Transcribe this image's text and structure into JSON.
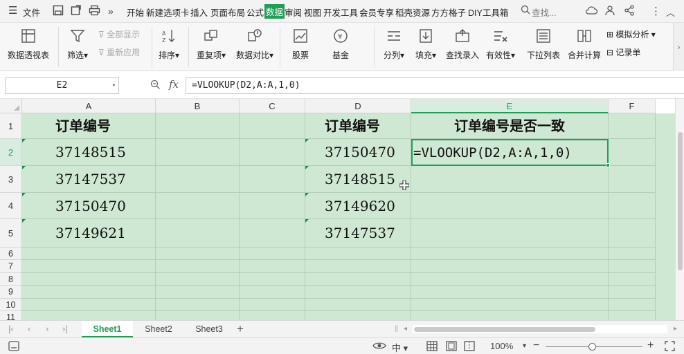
{
  "menubar": {
    "file_label": "文件",
    "tabs": [
      "开始",
      "新建选项卡",
      "插入",
      "页面布局",
      "公式",
      "数据",
      "审阅",
      "视图",
      "开发工具",
      "会员专享",
      "稻壳资源",
      "方方格子",
      "DIY工具箱"
    ],
    "active_tab": "数据",
    "search_label": "查找..."
  },
  "ribbon": {
    "pivot": "数据透视表",
    "filter": "筛选",
    "show_all": "全部显示",
    "reapply": "重新应用",
    "sort": "排序",
    "duplicates": "重复项",
    "compare": "数据对比",
    "stocks": "股票",
    "funds": "基金",
    "split": "分列",
    "fill": "填充",
    "lookup": "查找录入",
    "validity": "有效性",
    "dropdown": "下拉列表",
    "consolidate": "合并计算",
    "whatif": "模拟分析",
    "record": "记录单"
  },
  "formula_bar": {
    "name_box": "E2",
    "fx_label": "fx",
    "formula": "=VLOOKUP(D2,A:A,1,0)"
  },
  "columns": [
    "A",
    "B",
    "C",
    "D",
    "E",
    "F"
  ],
  "rows": [
    "1",
    "2",
    "3",
    "4",
    "5",
    "6",
    "7",
    "8",
    "9",
    "10",
    "11"
  ],
  "cells": {
    "A1": "订单编号",
    "D1": "订单编号",
    "E1": "订单编号是否一致",
    "A2": "37148515",
    "A3": "37147537",
    "A4": "37150470",
    "A5": "37149621",
    "D2": "37150470",
    "D3": "37148515",
    "D4": "37149620",
    "D5": "37147537",
    "E2": "=VLOOKUP(D2,A:A,1,0)"
  },
  "sheets": [
    "Sheet1",
    "Sheet2",
    "Sheet3"
  ],
  "active_sheet": "Sheet1",
  "status": {
    "zoom": "100%"
  },
  "colors": {
    "accent": "#1f9e58",
    "cell_fill": "#cfe8d3"
  }
}
